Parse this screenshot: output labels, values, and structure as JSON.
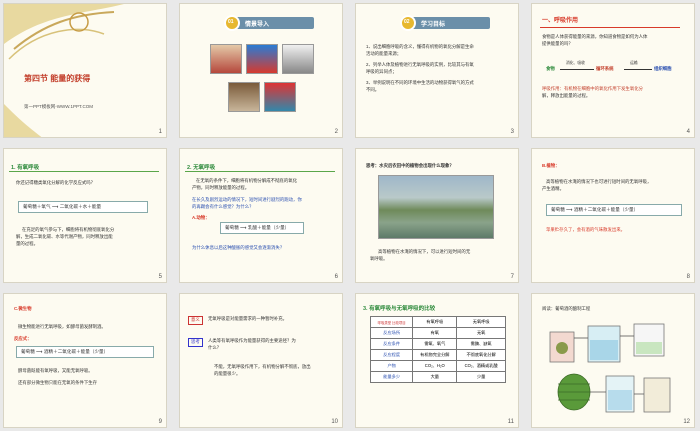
{
  "slides": [
    {
      "num": "1",
      "title": "第四节 能量的获得",
      "footer": "第一PPT模板网-WWW.1PPT.COM"
    },
    {
      "num": "2",
      "header": "情景导入",
      "badge": "01"
    },
    {
      "num": "3",
      "header": "学习目标",
      "badge": "02",
      "lines": [
        "1、说出细胞呼吸的含义，懂得有机物的氧化分解是生命",
        "活动的能量来源；",
        "2、列举人体及植物进行无氧呼吸的实例，比较其与有氧",
        "呼吸的异同点；",
        "3、举例说明在不同的环境中生活的动物获得氧气的方式",
        "不同。"
      ]
    },
    {
      "num": "4",
      "title": "一、呼吸作用",
      "q1": "食物是人体获得能量的来源，你知道食物是如何为人体",
      "q2": "提供能量的吗？",
      "chain": [
        "食物",
        "消化、吸收",
        "循环系统",
        "运输",
        "组织细胞"
      ],
      "def1": "呼吸作用：有机物在细胞中的氧化作用下发生氧化分",
      "def2": "解，释放出能量的过程。"
    },
    {
      "num": "5",
      "title": "1. 有氧呼吸",
      "q": "你还记得糖类氧化分解的化学反应式吗？",
      "formula": "葡萄糖＋氧气 ⟶ 二氧化碳＋水＋能量",
      "lines": [
        "在充足的氧气参与下，细胞将有机物彻底氧化分",
        "解，生成二氧化碳、水等代谢产物，同时释放出能",
        "量的过程。"
      ]
    },
    {
      "num": "6",
      "title": "2. 无氧呼吸",
      "lines": [
        "在无氧的条件下，细胞将有机物分解成不彻底的氧化",
        "产物，同时释放能量的过程。"
      ],
      "q": [
        "在长久及剧烈运动的情况下，短时间进行剧烈的跑动，你",
        "的再踢会有什么感觉？为什么？"
      ],
      "sub": "A.动物：",
      "formula": "葡萄糖 ⟶ 乳酸＋能量（少量）",
      "ask": "为什么休息以后这种酸胀的感觉又会逐渐消失？"
    },
    {
      "num": "7",
      "q": "思考：水灾后农田中的植物会出现什么现象？",
      "ans": [
        "高等植物在水淹的情况下，可以进行短时间的无",
        "氧呼吸。"
      ]
    },
    {
      "num": "8",
      "sub": "B.植物：",
      "lines": [
        "高等植物在水淹的情况下也可进行短时间的无氧呼吸，",
        "产生酒精。"
      ],
      "formula": "葡萄糖 ⟶ 酒精＋二氧化碳＋能量（少量）",
      "note": "苹果贮存久了，会有酒的气味散发出来。"
    },
    {
      "num": "9",
      "sub": "C.微生物",
      "lines": [
        "微生物能进行无氧呼吸，如酵母菌发酵制酒。"
      ],
      "label": "反应式：",
      "formula": "葡萄糖 ⟶ 酒精＋二氧化碳＋能量（少量）",
      "l2": "酵母菌既能有氧呼吸，又能无氧呼吸。",
      "l3": "还有部分微生物只能在无氧的条件下生存"
    },
    {
      "num": "10",
      "tag1": "意义",
      "t1": "无氧呼吸是对能量需求的一种暂时补充。",
      "tag2": "思考",
      "t2": [
        "人类等有氧呼吸作为能量获得的主要途径？为",
        "什么？"
      ],
      "t3": [
        "不能，无氧呼吸作用下，有机物分解不彻底，放出",
        "的能量很少。"
      ]
    },
    {
      "num": "11",
      "title": "3. 有氧呼吸与无氧呼吸的比较",
      "table": [
        [
          "呼吸类型\n比较项目",
          "有氧呼吸",
          "无氧呼吸"
        ],
        [
          "反应场所",
          "有氧",
          "无氧"
        ],
        [
          "反应条件",
          "需氧、氧气",
          "需酶、缺氧"
        ],
        [
          "反应程度",
          "有机物完全分解",
          "不彻底氧化分解"
        ],
        [
          "产物",
          "CO₂、H₂O",
          "CO₂、酒精或乳酸"
        ],
        [
          "能量多少",
          "大量",
          "少量"
        ]
      ]
    },
    {
      "num": "12",
      "title": "阅读：葡萄酒的酿制工程"
    }
  ]
}
